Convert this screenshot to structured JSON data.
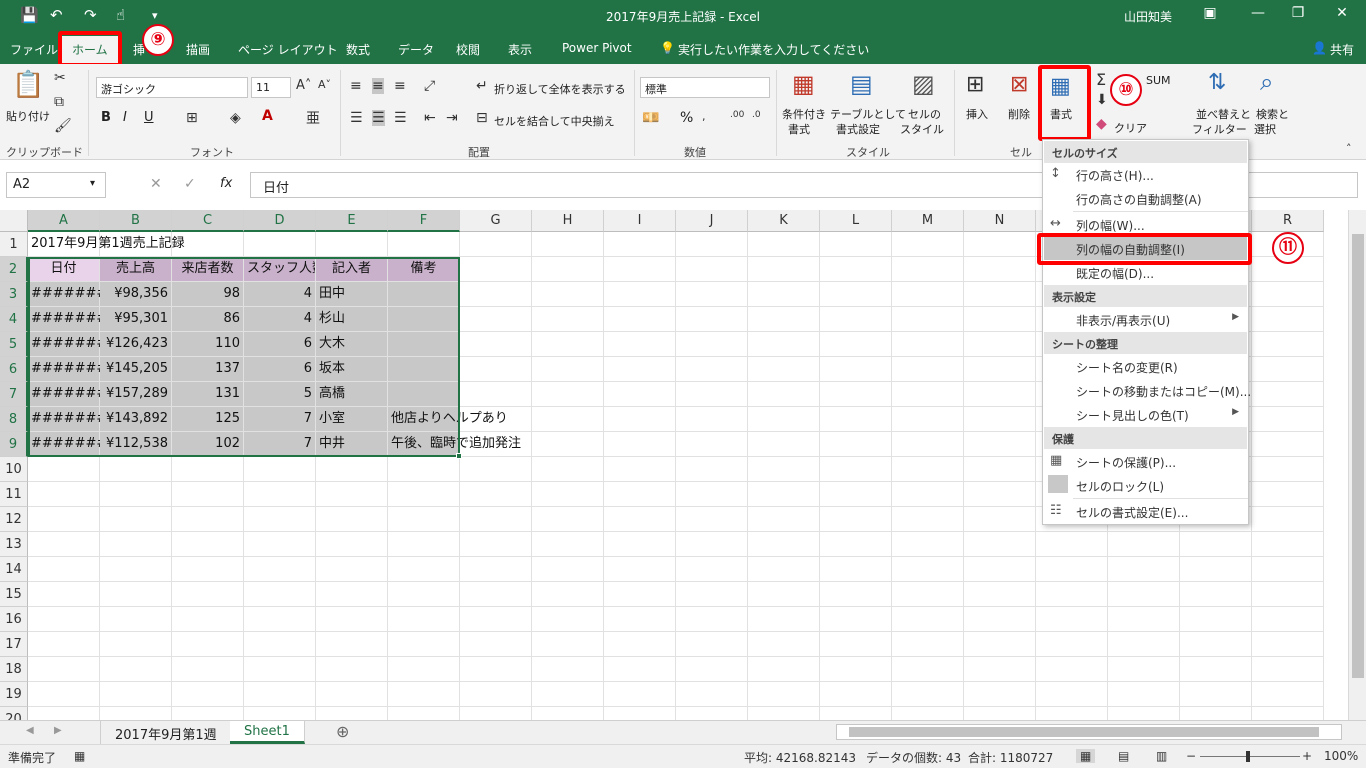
{
  "titlebar": {
    "title": "2017年9月売上記録  -  Excel",
    "user": "山田知美"
  },
  "tabs": [
    {
      "label": "ファイル"
    },
    {
      "label": "ホーム"
    },
    {
      "label": "挿"
    },
    {
      "label": "描画"
    },
    {
      "label": "ページ レイアウト"
    },
    {
      "label": "数式"
    },
    {
      "label": "データ"
    },
    {
      "label": "校閲"
    },
    {
      "label": "表示"
    },
    {
      "label": "Power Pivot"
    }
  ],
  "tell_me": "実行したい作業を入力してください",
  "share": "共有",
  "callouts": {
    "nine": "⑨",
    "ten": "⑩",
    "eleven": "⑪"
  },
  "ribbon": {
    "clipboard": {
      "paste": "貼り付け",
      "label": "クリップボード"
    },
    "font": {
      "name": "游ゴシック",
      "size": "11",
      "bold": "B",
      "italic": "I",
      "underline": "U",
      "label": "フォント"
    },
    "align": {
      "wrap": "折り返して全体を表示する",
      "merge": "セルを結合して中央揃え",
      "label": "配置"
    },
    "number": {
      "format": "標準",
      "percent": "%",
      "label": "数値"
    },
    "styles": {
      "cond_1": "条件付き",
      "cond_2": "書式",
      "table_1": "テーブルとして",
      "table_2": "書式設定",
      "cell_1": "セルの",
      "cell_2": "スタイル",
      "label": "スタイル"
    },
    "cells": {
      "insert": "挿入",
      "delete": "削除",
      "format": "書式",
      "label": "セル"
    },
    "editing": {
      "sum": "SUM",
      "clear": "クリア",
      "sort_1": "並べ替えと",
      "sort_2": "フィルター",
      "find_1": "検索と",
      "find_2": "選択"
    }
  },
  "formula_bar": {
    "name_box": "A2",
    "fx": "fx",
    "content": "日付"
  },
  "columns": [
    "A",
    "B",
    "C",
    "D",
    "E",
    "F",
    "G",
    "H",
    "I",
    "J",
    "K",
    "L",
    "M",
    "N",
    "O",
    "P",
    "Q",
    "R"
  ],
  "rows": [
    "1",
    "2",
    "3",
    "4",
    "5",
    "6",
    "7",
    "8",
    "9",
    "10",
    "11",
    "12",
    "13",
    "14",
    "15",
    "16",
    "17",
    "18",
    "19",
    "20"
  ],
  "sheet": {
    "title": "2017年9月第1週売上記録",
    "headers": [
      "日付",
      "売上高",
      "来店者数",
      "スタッフ人数",
      "記入者",
      "備考"
    ],
    "data": [
      [
        "#######",
        "¥98,356",
        "98",
        "4",
        "田中",
        ""
      ],
      [
        "#######",
        "¥95,301",
        "86",
        "4",
        "杉山",
        ""
      ],
      [
        "#######",
        "¥126,423",
        "110",
        "6",
        "大木",
        ""
      ],
      [
        "#######",
        "¥145,205",
        "137",
        "6",
        "坂本",
        ""
      ],
      [
        "#######",
        "¥157,289",
        "131",
        "5",
        "高橋",
        ""
      ],
      [
        "#######",
        "¥143,892",
        "125",
        "7",
        "小室",
        "他店よりヘルプあり"
      ],
      [
        "#######",
        "¥112,538",
        "102",
        "7",
        "中井",
        "午後、臨時で追加発注"
      ]
    ]
  },
  "menu": {
    "sec_size": "セルのサイズ",
    "row_height": "行の高さ(H)...",
    "row_autofit": "行の高さの自動調整(A)",
    "col_width": "列の幅(W)...",
    "col_autofit": "列の幅の自動調整(I)",
    "default_width": "既定の幅(D)...",
    "sec_visibility": "表示設定",
    "hide_unhide": "非表示/再表示(U)",
    "sec_organize": "シートの整理",
    "rename": "シート名の変更(R)",
    "move_copy": "シートの移動またはコピー(M)...",
    "tab_color": "シート見出しの色(T)",
    "sec_protect": "保護",
    "protect_sheet": "シートの保護(P)...",
    "lock_cell": "セルのロック(L)",
    "format_cells": "セルの書式設定(E)..."
  },
  "sheet_tabs": [
    "2017年9月第1週",
    "Sheet1"
  ],
  "status": {
    "ready": "準備完了",
    "average": "平均: 42168.82143",
    "count": "データの個数: 43",
    "sum": "合計: 1180727",
    "zoom": "100%"
  },
  "colors": {
    "accent": "#217346",
    "highlight": "#ff0000"
  }
}
